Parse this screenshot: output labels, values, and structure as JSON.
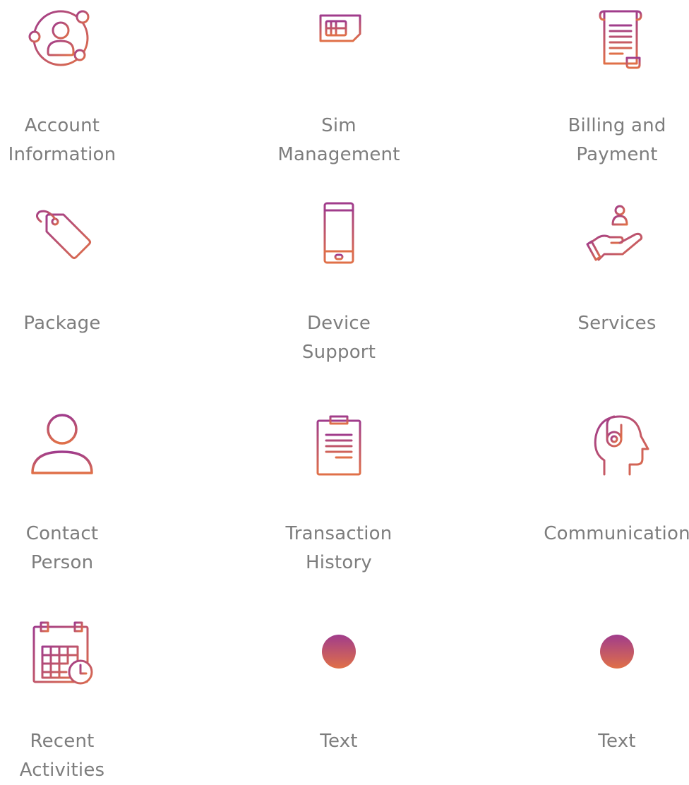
{
  "colors": {
    "gradient_top": "#a03c8c",
    "gradient_bottom": "#e07048",
    "label": "#7d7d7d",
    "background": "#ffffff"
  },
  "menu": {
    "items": [
      {
        "label": "Account\nInformation",
        "icon": "account-circle-icon"
      },
      {
        "label": "Sim\nManagement",
        "icon": "sim-card-icon"
      },
      {
        "label": "Billing and\nPayment",
        "icon": "invoice-scroll-icon"
      },
      {
        "label": "Package",
        "icon": "price-tag-icon"
      },
      {
        "label": "Device\nSupport",
        "icon": "smartphone-icon"
      },
      {
        "label": "Services",
        "icon": "hand-person-icon"
      },
      {
        "label": "Contact\nPerson",
        "icon": "person-icon"
      },
      {
        "label": "Transaction\nHistory",
        "icon": "clipboard-icon"
      },
      {
        "label": "Communication",
        "icon": "headset-head-icon"
      },
      {
        "label": "Recent\nActivities",
        "icon": "calendar-clock-icon"
      },
      {
        "label": "Text",
        "icon": "dot-icon"
      },
      {
        "label": "Text",
        "icon": "dot-icon"
      }
    ]
  }
}
